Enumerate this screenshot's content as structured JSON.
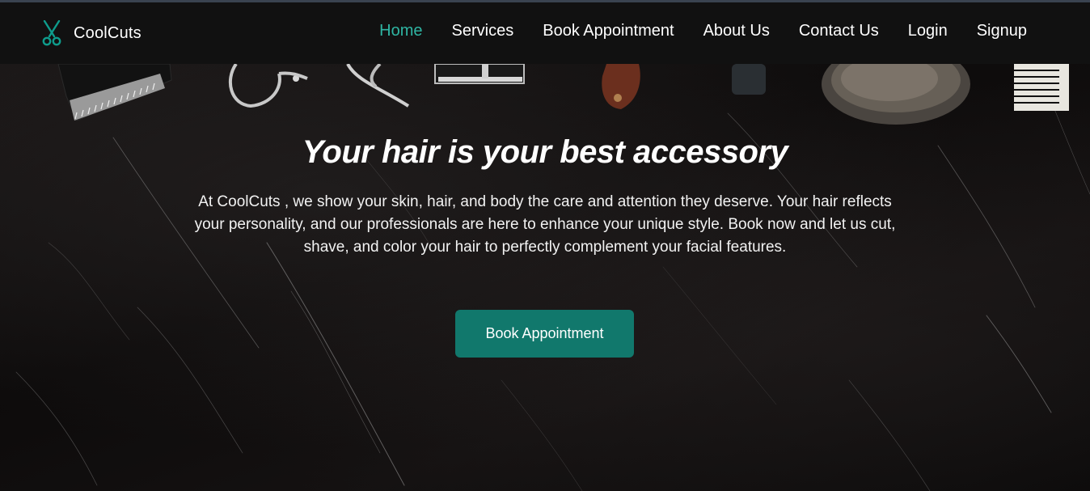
{
  "brand": {
    "name": "CoolCuts",
    "logo_icon": "scissors-icon",
    "accent_color": "#2fb5a3"
  },
  "nav": {
    "items": [
      {
        "label": "Home",
        "active": true
      },
      {
        "label": "Services",
        "active": false
      },
      {
        "label": "Book Appointment",
        "active": false
      },
      {
        "label": "About Us",
        "active": false
      },
      {
        "label": "Contact Us",
        "active": false
      },
      {
        "label": "Login",
        "active": false
      },
      {
        "label": "Signup",
        "active": false
      }
    ]
  },
  "hero": {
    "title": "Your hair is your best accessory",
    "description": "At CoolCuts , we show your skin, hair, and body the care and attention they deserve. Your hair reflects your personality, and our professionals are here to enhance your unique style. Book now and let us cut, shave, and color your hair to perfectly complement your facial features.",
    "cta_label": "Book Appointment",
    "cta_color": "#11786c"
  },
  "background": {
    "tools": [
      "hair-clipper-icon",
      "scissors-icon",
      "safety-razor-icon",
      "wooden-handle-icon",
      "trimmer-icon",
      "shaving-brush-icon",
      "comb-icon"
    ]
  }
}
